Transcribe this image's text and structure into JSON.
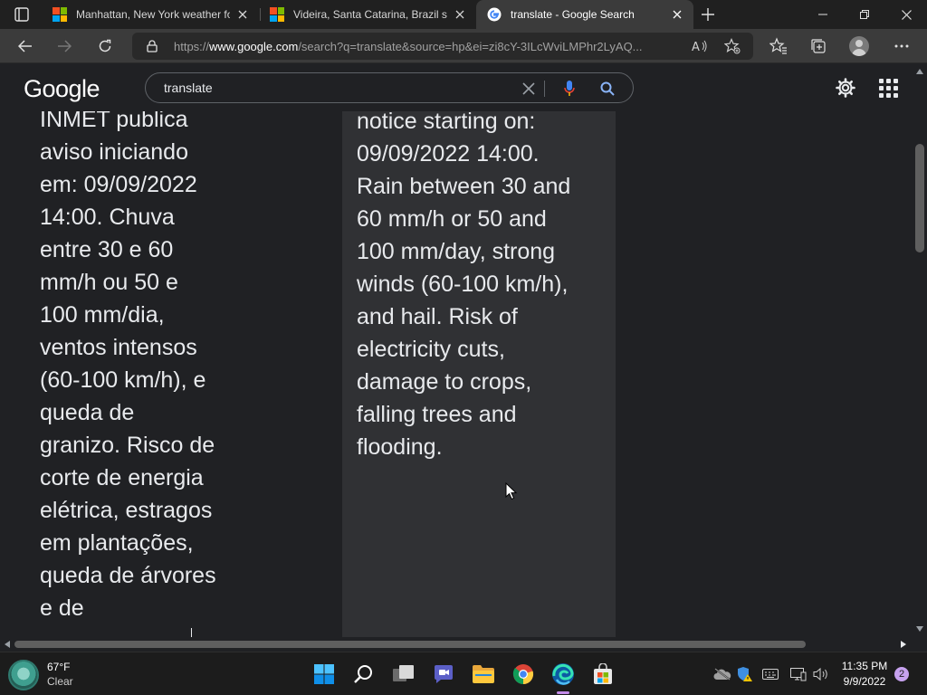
{
  "tabs": [
    {
      "title": "Manhattan, New York weather fo",
      "favicon": "msn-weather-favicon",
      "active": false
    },
    {
      "title": "Videira, Santa Catarina, Brazil sev",
      "favicon": "msn-weather-favicon",
      "active": false
    },
    {
      "title": "translate - Google Search",
      "favicon": "google-favicon",
      "active": true
    }
  ],
  "address_bar": {
    "url_prefix": "https://",
    "url_host": "www.google.com",
    "url_rest": "/search?q=translate&source=hp&ei=zi8cY-3ILcWviLMPhr2LyAQ..."
  },
  "google": {
    "logo": "Google",
    "query": "translate"
  },
  "translation": {
    "source_text": "INMET publica\naviso iniciando\nem: 09/09/2022\n14:00. Chuva\nentre 30 e 60\nmm/h ou 50 e\n100 mm/dia,\nventos intensos\n(60-100 km/h), e\nqueda de\ngranizo. Risco de\ncorte de energia\nelétrica, estragos\nem plantações,\nqueda de árvores\ne de",
    "target_text": "notice starting on:\n09/09/2022 14:00.\nRain between 30 and\n60 mm/h or 50 and\n100 mm/day, strong\nwinds (60-100 km/h),\nand hail. Risk of\nelectricity cuts,\ndamage to crops,\nfalling trees and\nflooding."
  },
  "taskbar": {
    "weather_temp": "67°F",
    "weather_desc": "Clear",
    "clock_time": "11:35 PM",
    "clock_date": "9/9/2022",
    "notification_count": "2"
  },
  "colors": {
    "page_bg": "#202124",
    "target_panel_bg": "#303134",
    "accent_edge": "#0078d4",
    "mic_blue": "#4285f4"
  }
}
